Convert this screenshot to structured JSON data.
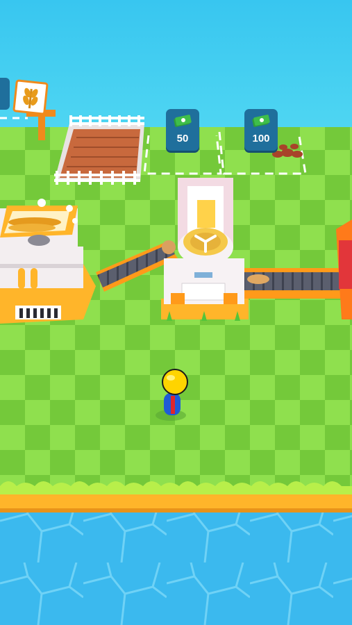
{
  "game": {
    "title": "",
    "unlock_slots": [
      {
        "price": "50",
        "icon": "cash-icon"
      },
      {
        "price": "100",
        "icon": "cash-icon"
      }
    ],
    "signpost": {
      "icon": "wheat-icon"
    },
    "buildings": [
      {
        "id": "wheat-farm-plot",
        "icon": "fence-icon"
      },
      {
        "id": "flour-mill",
        "icon": "wheat-icon"
      },
      {
        "id": "dough-mixer",
        "icon": "mixer-icon"
      },
      {
        "id": "oven-machine",
        "icon": "oven-icon"
      }
    ],
    "player": {
      "icon": "stickman-icon"
    },
    "colors": {
      "sky_water": "#35c8ef",
      "grass_light": "#8fe04e",
      "grass_dark": "#74c93a",
      "sand": "#ffb52a",
      "badge": "#1f6f9c",
      "cash": "#3fbe4a",
      "player_head": "#ffd400",
      "player_body": "#1f5bd6",
      "player_accent": "#e0262b"
    }
  }
}
